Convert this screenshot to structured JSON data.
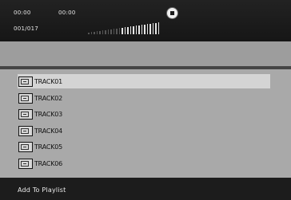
{
  "status": {
    "elapsed_time": "00:00",
    "total_time": "00:00",
    "track_counter": "001/017",
    "volume_level": 0.55,
    "stop_icon": "stop-icon"
  },
  "tracks": [
    {
      "label": "TRACK01",
      "icon": "file-icon",
      "selected": true
    },
    {
      "label": "TRACK02",
      "icon": "file-icon",
      "selected": false
    },
    {
      "label": "TRACK03",
      "icon": "file-icon",
      "selected": false
    },
    {
      "label": "TRACK04",
      "icon": "file-icon",
      "selected": false
    },
    {
      "label": "TRACK05",
      "icon": "file-icon",
      "selected": false
    },
    {
      "label": "TRACK06",
      "icon": "file-icon",
      "selected": false
    }
  ],
  "footer": {
    "label": "Add To Playlist"
  },
  "colors": {
    "status_bar": "#1c1c1c",
    "list_background": "#a9a9a9",
    "selected_row": "#d4d4d4"
  }
}
